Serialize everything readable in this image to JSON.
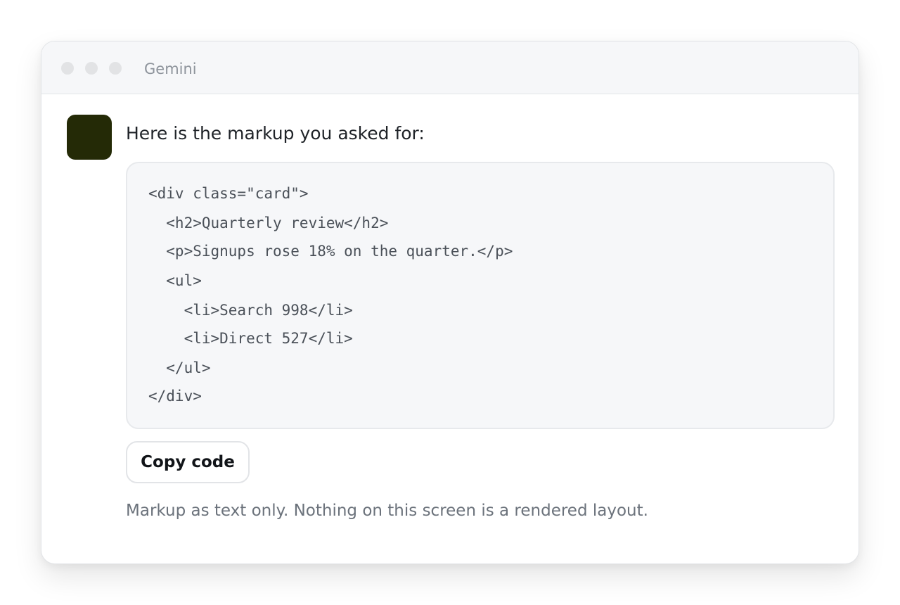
{
  "window": {
    "title": "Gemini"
  },
  "message": {
    "intro": "Here is the markup you asked for:",
    "code_lines": [
      "<div class=\"card\">",
      "  <h2>Quarterly review</h2>",
      "  <p>Signups rose 18% on the quarter.</p>",
      "  <ul>",
      "    <li>Search 998</li>",
      "    <li>Direct 527</li>",
      "  </ul>",
      "</div>"
    ],
    "copy_label": "Copy code",
    "footnote": "Markup as text only. Nothing on this screen is a rendered layout."
  },
  "colors": {
    "avatar": "#242a06",
    "code_background": "#f6f7f9",
    "titlebar_background": "#f6f7f9"
  }
}
